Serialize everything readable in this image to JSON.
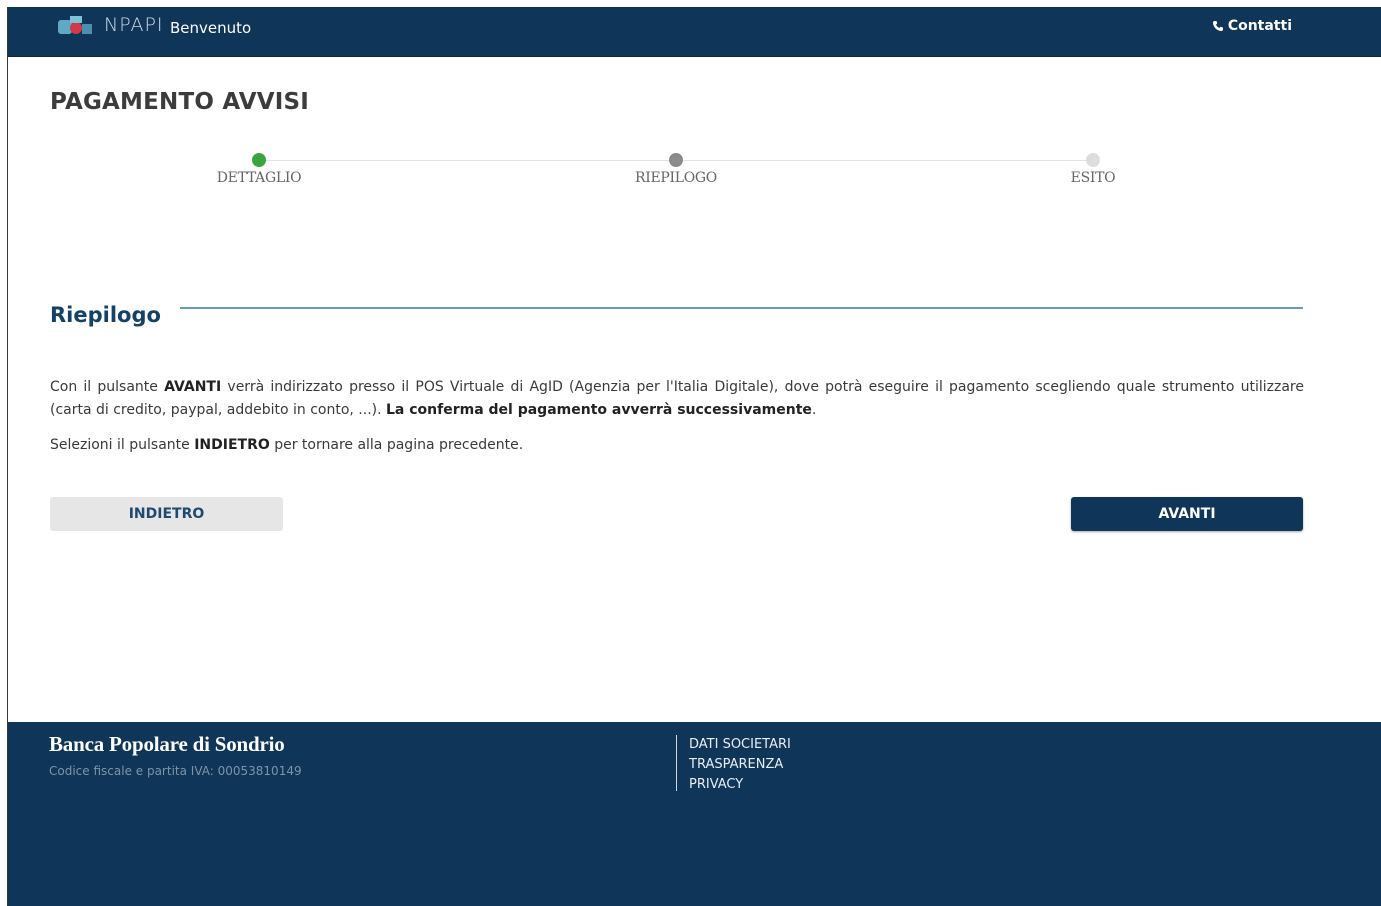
{
  "header": {
    "logo_text": "NPAPI",
    "welcome": "Benvenuto",
    "contacts_label": "Contatti",
    "contacts_icon": "phone-icon"
  },
  "page": {
    "title": "PAGAMENTO AVVISI"
  },
  "stepper": {
    "steps": [
      {
        "label": "DETTAGLIO",
        "state": "completed",
        "color": "#3aa53f"
      },
      {
        "label": "RIEPILOGO",
        "state": "current",
        "color": "#8a8a8a"
      },
      {
        "label": "ESITO",
        "state": "pending",
        "color": "#dddddd"
      }
    ]
  },
  "section": {
    "title": "Riepilogo"
  },
  "body": {
    "p1_a": "Con il pulsante ",
    "p1_b": "AVANTI",
    "p1_c": " verrà indirizzato presso il POS Virtuale di AgID (Agenzia per l'Italia Digitale), dove potrà eseguire il pagamento scegliendo quale strumento utilizzare (carta di credito, paypal, addebito in conto, ...). ",
    "p1_d": "La conferma del pagamento avverrà successivamente",
    "p1_e": ".",
    "p2_a": "Selezioni il pulsante ",
    "p2_b": "INDIETRO",
    "p2_c": " per tornare alla pagina precedente."
  },
  "buttons": {
    "back_label": "INDIETRO",
    "next_label": "AVANTI"
  },
  "footer": {
    "bank_name": "Banca Popolare di Sondrio",
    "tax_id": "Codice fiscale e partita IVA: 00053810149",
    "links": [
      "DATI SOCIETARI",
      "TRASPARENZA",
      "PRIVACY"
    ]
  },
  "colors": {
    "primary": "#0f3558",
    "accent_line": "#5d9fb8",
    "success": "#3aa53f"
  }
}
